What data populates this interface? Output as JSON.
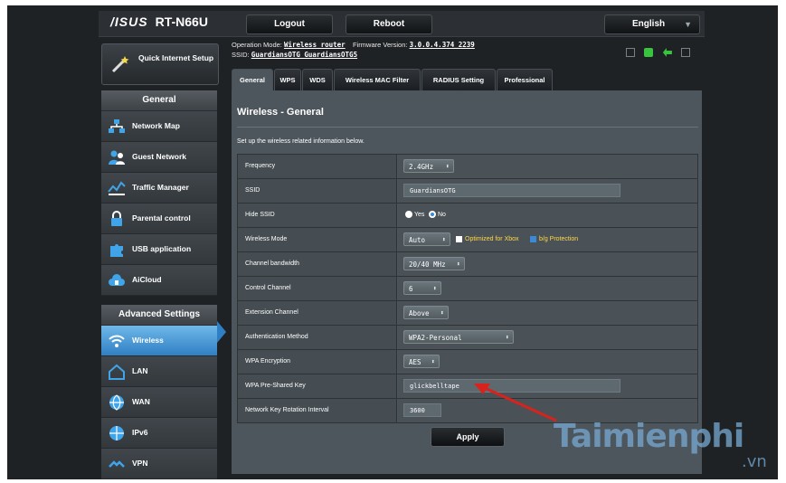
{
  "header": {
    "logo": "/ISUS",
    "model": "RT-N66U",
    "logout_label": "Logout",
    "reboot_label": "Reboot",
    "language": "English"
  },
  "sidebar": {
    "quick_setup": "Quick Internet Setup",
    "general_title": "General",
    "general_items": [
      {
        "label": "Network Map",
        "icon": "network-map-icon"
      },
      {
        "label": "Guest Network",
        "icon": "guest-network-icon"
      },
      {
        "label": "Traffic Manager",
        "icon": "traffic-manager-icon"
      },
      {
        "label": "Parental control",
        "icon": "parental-control-icon"
      },
      {
        "label": "USB application",
        "icon": "usb-application-icon"
      },
      {
        "label": "AiCloud",
        "icon": "aicloud-icon"
      }
    ],
    "advanced_title": "Advanced Settings",
    "advanced_items": [
      {
        "label": "Wireless",
        "icon": "wireless-icon",
        "active": true
      },
      {
        "label": "LAN",
        "icon": "lan-icon"
      },
      {
        "label": "WAN",
        "icon": "wan-icon"
      },
      {
        "label": "IPv6",
        "icon": "ipv6-icon"
      },
      {
        "label": "VPN",
        "icon": "vpn-icon"
      }
    ]
  },
  "status": {
    "op_mode_label": "Operation Mode:",
    "op_mode_value": "Wireless router",
    "firmware_label": "Firmware Version:",
    "firmware_value": "3.0.0.4.374_2239",
    "ssid_label": "SSID:",
    "ssid_values": "GuardiansOTG GuardiansOTG5"
  },
  "tabs": [
    "General",
    "WPS",
    "WDS",
    "Wireless MAC Filter",
    "RADIUS Setting",
    "Professional"
  ],
  "page": {
    "title": "Wireless - General",
    "description": "Set up the wireless related information below."
  },
  "form": {
    "frequency_label": "Frequency",
    "frequency_value": "2.4GHz",
    "ssid_label": "SSID",
    "ssid_value": "GuardiansOTG",
    "hide_ssid_label": "Hide SSID",
    "hide_yes": "Yes",
    "hide_no": "No",
    "wireless_mode_label": "Wireless Mode",
    "wireless_mode_value": "Auto",
    "xbox_opt": "Optimized for Xbox",
    "bg_protection": "b/g Protection",
    "channel_bw_label": "Channel bandwidth",
    "channel_bw_value": "20/40 MHz",
    "control_channel_label": "Control Channel",
    "control_channel_value": "6",
    "ext_channel_label": "Extension Channel",
    "ext_channel_value": "Above",
    "auth_label": "Authentication Method",
    "auth_value": "WPA2-Personal",
    "enc_label": "WPA Encryption",
    "enc_value": "AES",
    "psk_label": "WPA Pre-Shared Key",
    "psk_value": "glickbelltape",
    "rotation_label": "Network Key Rotation Interval",
    "rotation_value": "3600"
  },
  "apply_label": "Apply",
  "watermark": {
    "main": "Taimienphi",
    "sub": ".vn"
  }
}
